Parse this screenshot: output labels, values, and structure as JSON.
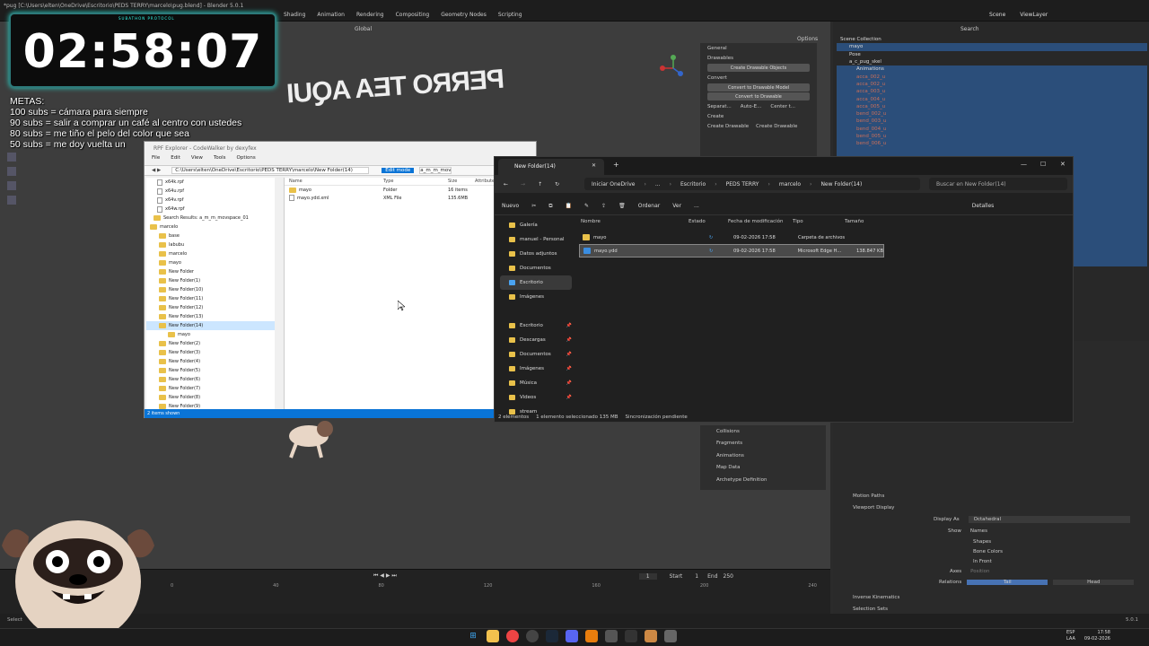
{
  "blender": {
    "title": "*pug [C:\\Users\\elten\\OneDrive\\Escritorio\\PEDS TERRY\\marcelo\\pug.blend] - Blender 5.0.1",
    "workspaces": [
      "Shading",
      "Animation",
      "Rendering",
      "Compositing",
      "Geometry Nodes",
      "Scripting"
    ],
    "scene": "Scene",
    "view_layer": "ViewLayer",
    "transform_orientation": "Global",
    "options": "Options",
    "outliner_search": "Search",
    "outliner_root": "Scene Collection",
    "outliner_rows": [
      {
        "label": "mayo",
        "cls": "sel"
      },
      {
        "label": "Pose",
        "cls": ""
      },
      {
        "label": "a_c_pug_skel",
        "cls": ""
      },
      {
        "label": "Animations",
        "cls": "sel"
      },
      {
        "label": "acca_002_u",
        "cls": "sel cat"
      },
      {
        "label": "acca_002_u",
        "cls": "sel cat"
      },
      {
        "label": "acca_003_u",
        "cls": "sel cat"
      },
      {
        "label": "acca_004_u",
        "cls": "sel cat"
      },
      {
        "label": "acca_005_u",
        "cls": "sel cat"
      },
      {
        "label": "bend_002_u",
        "cls": "sel cat"
      },
      {
        "label": "bend_003_u",
        "cls": "sel cat"
      },
      {
        "label": "bend_004_u",
        "cls": "sel cat"
      },
      {
        "label": "bend_005_u",
        "cls": "sel cat"
      },
      {
        "label": "bend_006_u",
        "cls": "sel cat"
      },
      {
        "label": "",
        "cls": "sel"
      },
      {
        "label": "",
        "cls": "sel"
      },
      {
        "label": "",
        "cls": "sel"
      },
      {
        "label": "",
        "cls": "sel"
      },
      {
        "label": "",
        "cls": "sel"
      },
      {
        "label": "",
        "cls": "sel"
      },
      {
        "label": "",
        "cls": "sel"
      },
      {
        "label": "",
        "cls": "sel"
      },
      {
        "label": "",
        "cls": "sel"
      },
      {
        "label": "",
        "cls": "sel"
      },
      {
        "label": "",
        "cls": "sel"
      },
      {
        "label": "",
        "cls": "sel"
      },
      {
        "label": "",
        "cls": "sel"
      },
      {
        "label": "",
        "cls": "sel"
      },
      {
        "label": "",
        "cls": "sel"
      },
      {
        "label": "",
        "cls": "sel"
      }
    ],
    "npanel": {
      "general": "General",
      "drawables": "Drawables",
      "create_drawable_objects": "Create Drawable Objects",
      "convert": "Convert",
      "convert_to_drawable_model": "Convert to Drawable Model",
      "convert_to_drawable": "Convert to Drawable",
      "separate": "Separat...",
      "auto_e": "Auto-E...",
      "center": "Center t...",
      "create": "Create",
      "create_drawable": "Create Drawable",
      "create_drawable2": "Create Drawable"
    },
    "npanel2": [
      "Collisions",
      "Fragments",
      "Animations",
      "Map Data",
      "Archetype Definition"
    ],
    "props": {
      "motion_paths": "Motion Paths",
      "viewport_display": "Viewport Display",
      "display_as_label": "Display As",
      "display_as_value": "Octahedral",
      "show_label": "Show",
      "show_names": "Names",
      "show_shapes": "Shapes",
      "show_bone_colors": "Bone Colors",
      "show_in_front": "In Front",
      "axes_label": "Axes",
      "axes_value": "Position",
      "relations_label": "Relations",
      "relations_tail": "Tail",
      "relations_head": "Head",
      "inverse_kinematics": "Inverse Kinematics",
      "selection_sets": "Selection Sets"
    },
    "timeline": {
      "frame": "1",
      "start_label": "Start",
      "start_value": "1",
      "end_label": "End",
      "end_value": "250",
      "ruler": [
        "0",
        "40",
        "80",
        "120",
        "160",
        "200",
        "240"
      ],
      "select": "Select",
      "version": "5.0.1"
    }
  },
  "overlay": {
    "timer": "02:58:07",
    "timer_tag": "SUBATHON PROTOCOL",
    "metas_title": "METAS:",
    "metas": [
      "100 subs = cámara para siempre",
      "90 subs = salir a comprar un café al centro con ustedes",
      "80 subs = me tiño el pelo del color que sea",
      "50 subs = me doy vuelta un"
    ],
    "neon_text": "PERRO TEA AQUI"
  },
  "codewalker": {
    "title": "RPF Explorer - CodeWalker by dexyfex",
    "menu": [
      "File",
      "Edit",
      "View",
      "Tools",
      "Options"
    ],
    "address": "C:\\Users\\elten\\OneDrive\\Escritorio\\PEDS TERRY\\marcelo\\New Folder(14)",
    "edit_mode": "Edit mode",
    "search_box": "a_m_m_movs",
    "tree": [
      {
        "label": "x64k.rpf",
        "type": "file",
        "indent": 12
      },
      {
        "label": "x64u.rpf",
        "type": "file",
        "indent": 12
      },
      {
        "label": "x64v.rpf",
        "type": "file",
        "indent": 12
      },
      {
        "label": "x64w.rpf",
        "type": "file",
        "indent": 12
      },
      {
        "label": "Search Results: a_m_m_movspace_01",
        "type": "folder",
        "indent": 8
      },
      {
        "label": "marcelo",
        "type": "folder",
        "indent": 4
      },
      {
        "label": "base",
        "type": "folder",
        "indent": 14
      },
      {
        "label": "labubu",
        "type": "folder",
        "indent": 14
      },
      {
        "label": "marcelo",
        "type": "folder",
        "indent": 14
      },
      {
        "label": "mayo",
        "type": "folder",
        "indent": 14
      },
      {
        "label": "New Folder",
        "type": "folder",
        "indent": 14
      },
      {
        "label": "New Folder(1)",
        "type": "folder",
        "indent": 14
      },
      {
        "label": "New Folder(10)",
        "type": "folder",
        "indent": 14
      },
      {
        "label": "New Folder(11)",
        "type": "folder",
        "indent": 14
      },
      {
        "label": "New Folder(12)",
        "type": "folder",
        "indent": 14
      },
      {
        "label": "New Folder(13)",
        "type": "folder",
        "indent": 14
      },
      {
        "label": "New Folder(14)",
        "type": "folder",
        "indent": 14,
        "sel": true
      },
      {
        "label": "mayo",
        "type": "folder",
        "indent": 24
      },
      {
        "label": "New Folder(2)",
        "type": "folder",
        "indent": 14
      },
      {
        "label": "New Folder(3)",
        "type": "folder",
        "indent": 14
      },
      {
        "label": "New Folder(4)",
        "type": "folder",
        "indent": 14
      },
      {
        "label": "New Folder(5)",
        "type": "folder",
        "indent": 14
      },
      {
        "label": "New Folder(6)",
        "type": "folder",
        "indent": 14
      },
      {
        "label": "New Folder(7)",
        "type": "folder",
        "indent": 14
      },
      {
        "label": "New Folder(8)",
        "type": "folder",
        "indent": 14
      },
      {
        "label": "New Folder(9)",
        "type": "folder",
        "indent": 14
      }
    ],
    "columns": [
      "Name",
      "Type",
      "Size",
      "Attributes"
    ],
    "files": [
      {
        "name": "mayo",
        "type": "Folder",
        "size": "16 items",
        "icon": "folder"
      },
      {
        "name": "mayo.ydd.xml",
        "type": "XML File",
        "size": "135.6MB",
        "icon": "file"
      }
    ],
    "status": "2 items shown"
  },
  "explorer": {
    "tab": "New Folder(14)",
    "crumbs": [
      "Iniciar OneDrive",
      "...",
      "Escritorio",
      "PEDS TERRY",
      "marcelo",
      "New Folder(14)"
    ],
    "search_placeholder": "Buscar en New Folder(14)",
    "cmd": {
      "new": "Nuevo",
      "sort": "Ordenar",
      "view": "Ver",
      "more": "...",
      "details": "Detalles"
    },
    "nav": [
      {
        "label": "Galería",
        "sel": false,
        "pin": false
      },
      {
        "label": "manuel - Personal",
        "sel": false,
        "pin": false
      },
      {
        "label": "Datos adjuntos",
        "sel": false,
        "pin": false
      },
      {
        "label": "Documentos",
        "sel": false,
        "pin": false
      },
      {
        "label": "Escritorio",
        "sel": true,
        "pin": false
      },
      {
        "label": "Imágenes",
        "sel": false,
        "pin": false
      },
      {
        "label": "",
        "sel": false,
        "pin": false
      },
      {
        "label": "Escritorio",
        "sel": false,
        "pin": true
      },
      {
        "label": "Descargas",
        "sel": false,
        "pin": true
      },
      {
        "label": "Documentos",
        "sel": false,
        "pin": true
      },
      {
        "label": "Imágenes",
        "sel": false,
        "pin": true
      },
      {
        "label": "Música",
        "sel": false,
        "pin": true
      },
      {
        "label": "Videos",
        "sel": false,
        "pin": true
      },
      {
        "label": "stream",
        "sel": false,
        "pin": false
      }
    ],
    "columns": [
      "Nombre",
      "Estado",
      "Fecha de modificación",
      "Tipo",
      "Tamaño"
    ],
    "files": [
      {
        "name": "mayo",
        "date": "09-02-2026 17:58",
        "type": "Carpeta de archivos",
        "size": "",
        "sel": false,
        "icon": "folder"
      },
      {
        "name": "mayo.ydd",
        "date": "09-02-2026 17:58",
        "type": "Microsoft Edge H...",
        "size": "138.847 KB",
        "sel": true,
        "icon": "file"
      }
    ],
    "status": [
      "2 elementos",
      "1 elemento seleccionado  135 MB",
      "Sincronización pendiente"
    ]
  },
  "taskbar": {
    "lang": "ESP\nLAA",
    "time": "17:58",
    "date": "09-02-2026"
  }
}
